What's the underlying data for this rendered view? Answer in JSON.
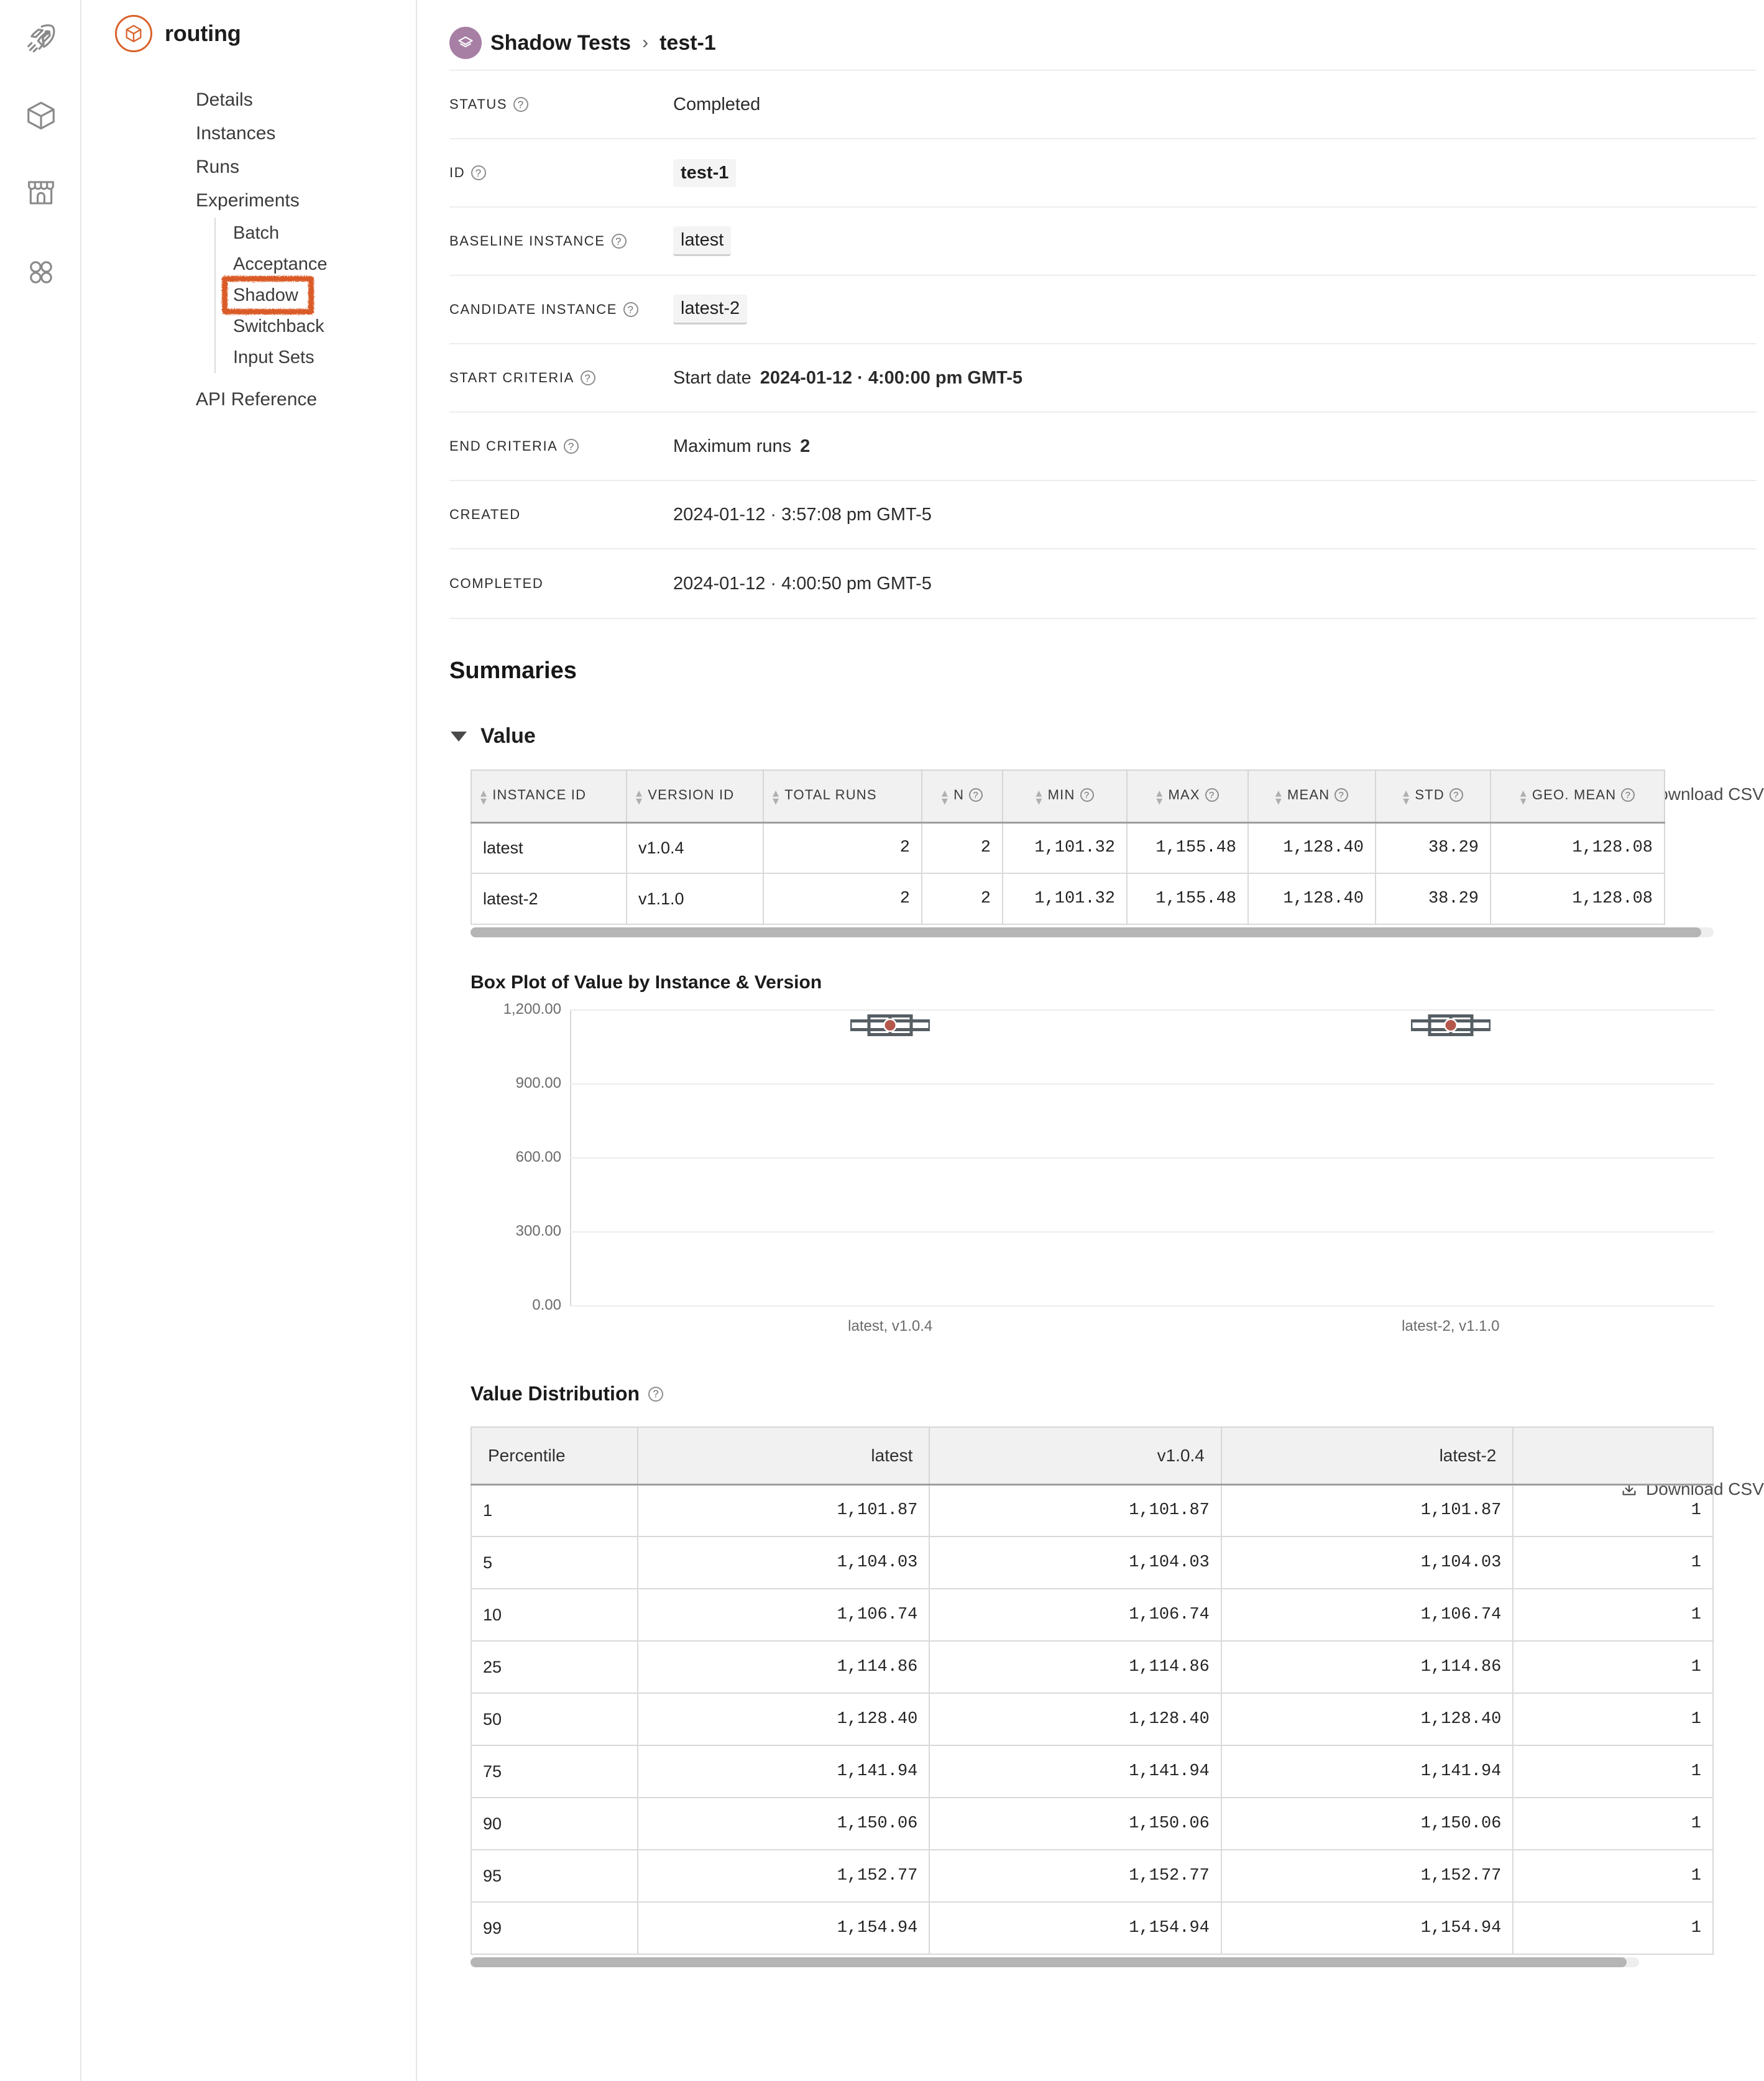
{
  "rail": {
    "items": [
      {
        "name": "rocket-icon",
        "label": "Deployments"
      },
      {
        "name": "cube-icon",
        "label": "Applications"
      },
      {
        "name": "marketplace-icon",
        "label": "Marketplace"
      },
      {
        "name": "apps-grid-icon",
        "label": "Apps"
      }
    ]
  },
  "sidebar": {
    "project_name": "routing",
    "logo_icon": "cube-outline-icon",
    "items": [
      {
        "label": "Details"
      },
      {
        "label": "Instances"
      },
      {
        "label": "Runs"
      },
      {
        "label": "Experiments"
      }
    ],
    "sub_items": [
      {
        "label": "Batch"
      },
      {
        "label": "Acceptance"
      },
      {
        "label": "Shadow",
        "highlighted": true
      },
      {
        "label": "Switchback"
      },
      {
        "label": "Input Sets"
      }
    ],
    "api_reference": "API Reference",
    "highlight_color": "#d9531e"
  },
  "breadcrumb": {
    "badge_icon": "layers-icon",
    "badge_color": "#a77fa5",
    "parent": "Shadow Tests",
    "separator": "›",
    "current": "test-1"
  },
  "details": [
    {
      "label": "STATUS",
      "help": true,
      "value": "Completed",
      "style": "plain"
    },
    {
      "label": "ID",
      "help": true,
      "value": "test-1",
      "style": "chip"
    },
    {
      "label": "BASELINE INSTANCE",
      "help": true,
      "value": "latest",
      "style": "chip-link"
    },
    {
      "label": "CANDIDATE INSTANCE",
      "help": true,
      "value": "latest-2",
      "style": "chip-link"
    },
    {
      "label": "START CRITERIA",
      "help": true,
      "prefix": "Start date",
      "value": "2024-01-12 · 4:00:00 pm GMT-5",
      "style": "prefix-strong"
    },
    {
      "label": "END CRITERIA",
      "help": true,
      "prefix": "Maximum runs",
      "value": "2",
      "style": "prefix-strong"
    },
    {
      "label": "CREATED",
      "help": false,
      "value": "2024-01-12 · 3:57:08 pm GMT-5",
      "style": "plain"
    },
    {
      "label": "COMPLETED",
      "help": false,
      "value": "2024-01-12 · 4:00:50 pm GMT-5",
      "style": "plain"
    }
  ],
  "summaries": {
    "title": "Summaries",
    "value_section_label": "Value",
    "download_csv_label": "Download CSV",
    "download_icon": "download-icon"
  },
  "value_table": {
    "columns": [
      {
        "label": "INSTANCE ID",
        "sortable": true,
        "help": false,
        "align": "left"
      },
      {
        "label": "VERSION ID",
        "sortable": true,
        "help": false,
        "align": "left"
      },
      {
        "label": "TOTAL RUNS",
        "sortable": true,
        "help": false,
        "align": "right"
      },
      {
        "label": "N",
        "sortable": true,
        "help": true,
        "align": "right"
      },
      {
        "label": "MIN",
        "sortable": true,
        "help": true,
        "align": "right"
      },
      {
        "label": "MAX",
        "sortable": true,
        "help": true,
        "align": "right"
      },
      {
        "label": "MEAN",
        "sortable": true,
        "help": true,
        "align": "right"
      },
      {
        "label": "STD",
        "sortable": true,
        "help": true,
        "align": "right"
      },
      {
        "label": "GEO. MEAN",
        "sortable": true,
        "help": true,
        "align": "right"
      }
    ],
    "rows": [
      [
        "latest",
        "v1.0.4",
        "2",
        "2",
        "1,101.32",
        "1,155.48",
        "1,128.40",
        "38.29",
        "1,128.08"
      ],
      [
        "latest-2",
        "v1.1.0",
        "2",
        "2",
        "1,101.32",
        "1,155.48",
        "1,128.40",
        "38.29",
        "1,128.08"
      ]
    ]
  },
  "chart_data": {
    "type": "box",
    "title": "Box Plot of Value by Instance & Version",
    "xlabel": "",
    "ylabel": "",
    "ylim": [
      0,
      1300
    ],
    "yticks": [
      0,
      300,
      600,
      900,
      1200
    ],
    "ytick_labels": [
      "0.00",
      "300.00",
      "600.00",
      "900.00",
      "1,200.00"
    ],
    "grid": true,
    "categories": [
      "latest, v1.0.4",
      "latest-2, v1.1.0"
    ],
    "series": [
      {
        "name": "latest, v1.0.4",
        "min": 1101.32,
        "q1": 1114.86,
        "median": 1128.4,
        "q3": 1141.94,
        "max": 1155.48,
        "mean": 1128.4,
        "mean_marker_color": "#b5584c"
      },
      {
        "name": "latest-2, v1.1.0",
        "min": 1101.32,
        "q1": 1114.86,
        "median": 1128.4,
        "q3": 1141.94,
        "max": 1155.48,
        "mean": 1128.4,
        "mean_marker_color": "#b5584c"
      }
    ]
  },
  "value_distribution": {
    "title": "Value Distribution",
    "help": true,
    "download_csv_label": "Download CSV",
    "columns": [
      "Percentile",
      "latest",
      "v1.0.4",
      "latest-2",
      ""
    ],
    "rows": [
      [
        "1",
        "1,101.87",
        "1,101.87",
        "1,101.87",
        "1"
      ],
      [
        "5",
        "1,104.03",
        "1,104.03",
        "1,104.03",
        "1"
      ],
      [
        "10",
        "1,106.74",
        "1,106.74",
        "1,106.74",
        "1"
      ],
      [
        "25",
        "1,114.86",
        "1,114.86",
        "1,114.86",
        "1"
      ],
      [
        "50",
        "1,128.40",
        "1,128.40",
        "1,128.40",
        "1"
      ],
      [
        "75",
        "1,141.94",
        "1,141.94",
        "1,141.94",
        "1"
      ],
      [
        "90",
        "1,150.06",
        "1,150.06",
        "1,150.06",
        "1"
      ],
      [
        "95",
        "1,152.77",
        "1,152.77",
        "1,152.77",
        "1"
      ],
      [
        "99",
        "1,154.94",
        "1,154.94",
        "1,154.94",
        "1"
      ]
    ]
  }
}
